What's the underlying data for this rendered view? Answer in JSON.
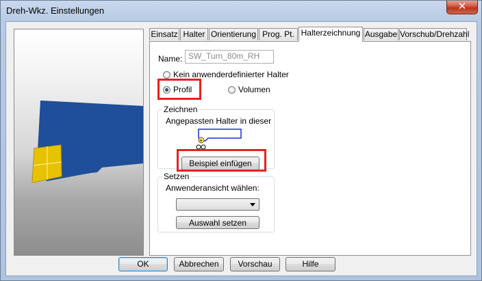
{
  "window": {
    "title": "Dreh-Wkz. Einstellungen",
    "close_symbol": "✕",
    "accent_highlight_color": "#e8201f"
  },
  "tabs": [
    {
      "label": "Einsatz"
    },
    {
      "label": "Halter"
    },
    {
      "label": "Orientierung"
    },
    {
      "label": "Prog. Pt."
    },
    {
      "label": "Halterzeichnung",
      "active": true
    },
    {
      "label": "Ausgabe"
    },
    {
      "label": "Vorschub/Drehzahl"
    }
  ],
  "panel": {
    "name_label": "Name:",
    "name_value": "SW_Turn_80m_RH",
    "radio_none_label": "Kein anwenderdefinierter Halter",
    "radio_profile_label": "Profil",
    "radio_volume_label": "Volumen",
    "selected_option": "Profil",
    "draw_group": {
      "title": "Zeichnen",
      "description": "Angepassten Halter in dieser",
      "insert_example_button": "Beispiel einfügen"
    },
    "set_group": {
      "title": "Setzen",
      "user_view_label": "Anwenderansicht wählen:",
      "user_view_value": "",
      "apply_selection_button": "Auswahl setzen"
    }
  },
  "footer": {
    "ok": "OK",
    "cancel": "Abbrechen",
    "preview": "Vorschau",
    "help": "Hilfe"
  }
}
